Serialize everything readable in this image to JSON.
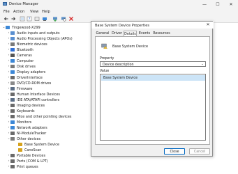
{
  "window": {
    "title": "Device Manager",
    "controls": {
      "minimize": "—",
      "maximize": "☐",
      "close": "✕"
    }
  },
  "menu": [
    "File",
    "Action",
    "View",
    "Help"
  ],
  "toolbar_icons": [
    "back-arrow-icon",
    "forward-arrow-icon",
    "properties-icon",
    "help-icon",
    "show-hidden-icon",
    "scan-hardware-icon",
    "update-driver-icon",
    "disable-device-icon",
    "uninstall-icon"
  ],
  "tree": {
    "root": "Tingewood-X299",
    "items": [
      {
        "label": "Audio inputs and outputs",
        "icon": "audio-icon",
        "color": "#5a8fd0"
      },
      {
        "label": "Audio Processing Objects (APOs)",
        "icon": "audio-icon",
        "color": "#5a8fd0"
      },
      {
        "label": "Biometric devices",
        "icon": "biometric-icon",
        "color": "#7a7a7a"
      },
      {
        "label": "Bluetooth",
        "icon": "bluetooth-icon",
        "color": "#2f6fd6"
      },
      {
        "label": "Cameras",
        "icon": "camera-icon",
        "color": "#555555"
      },
      {
        "label": "Computer",
        "icon": "computer-icon",
        "color": "#3c87d6"
      },
      {
        "label": "Disk drives",
        "icon": "disk-icon",
        "color": "#7a7a7a"
      },
      {
        "label": "Display adapters",
        "icon": "display-icon",
        "color": "#3c87d6"
      },
      {
        "label": "DriverInterface",
        "icon": "device-icon",
        "color": "#6a6a6a"
      },
      {
        "label": "DVD/CD-ROM drives",
        "icon": "dvd-icon",
        "color": "#8a8a8a"
      },
      {
        "label": "Firmware",
        "icon": "firmware-icon",
        "color": "#5b6e86"
      },
      {
        "label": "Human Interface Devices",
        "icon": "hid-icon",
        "color": "#6a6a6a"
      },
      {
        "label": "IDE ATA/ATAPI controllers",
        "icon": "ide-icon",
        "color": "#5b6e86"
      },
      {
        "label": "Imaging devices",
        "icon": "imaging-icon",
        "color": "#6a6a6a"
      },
      {
        "label": "Keyboards",
        "icon": "keyboard-icon",
        "color": "#6a6a6a"
      },
      {
        "label": "Mice and other pointing devices",
        "icon": "mouse-icon",
        "color": "#6a6a6a"
      },
      {
        "label": "Monitors",
        "icon": "monitor-icon",
        "color": "#3c87d6"
      },
      {
        "label": "Network adapters",
        "icon": "network-icon",
        "color": "#3c87d6"
      },
      {
        "label": "NI-ModuleTracker",
        "icon": "device-icon",
        "color": "#6a6a6a"
      },
      {
        "label": "Other devices",
        "icon": "other-devices-icon",
        "color": "#7a7a7a",
        "expanded": true
      },
      {
        "label": "Base System Device",
        "icon": "warning-device-icon",
        "color": "#d6a21c",
        "child": true
      },
      {
        "label": "CanoScan",
        "icon": "warning-device-icon",
        "color": "#d6a21c",
        "child": true
      },
      {
        "label": "Portable Devices",
        "icon": "portable-icon",
        "color": "#6a6a6a"
      },
      {
        "label": "Ports (COM & LPT)",
        "icon": "port-icon",
        "color": "#6a6a6a"
      },
      {
        "label": "Print queues",
        "icon": "printer-icon",
        "color": "#6a6a6a"
      }
    ]
  },
  "dialog": {
    "title": "Base System Device Properties",
    "close": "✕",
    "tabs": [
      "General",
      "Driver",
      "Details",
      "Events",
      "Resources"
    ],
    "active_tab": "Details",
    "device_name": "Base System Device",
    "property_label": "Property",
    "property_value": "Device description",
    "value_label": "Value",
    "value_item": "Base System Device",
    "buttons": {
      "close": "Close",
      "cancel": "Cancel"
    }
  }
}
